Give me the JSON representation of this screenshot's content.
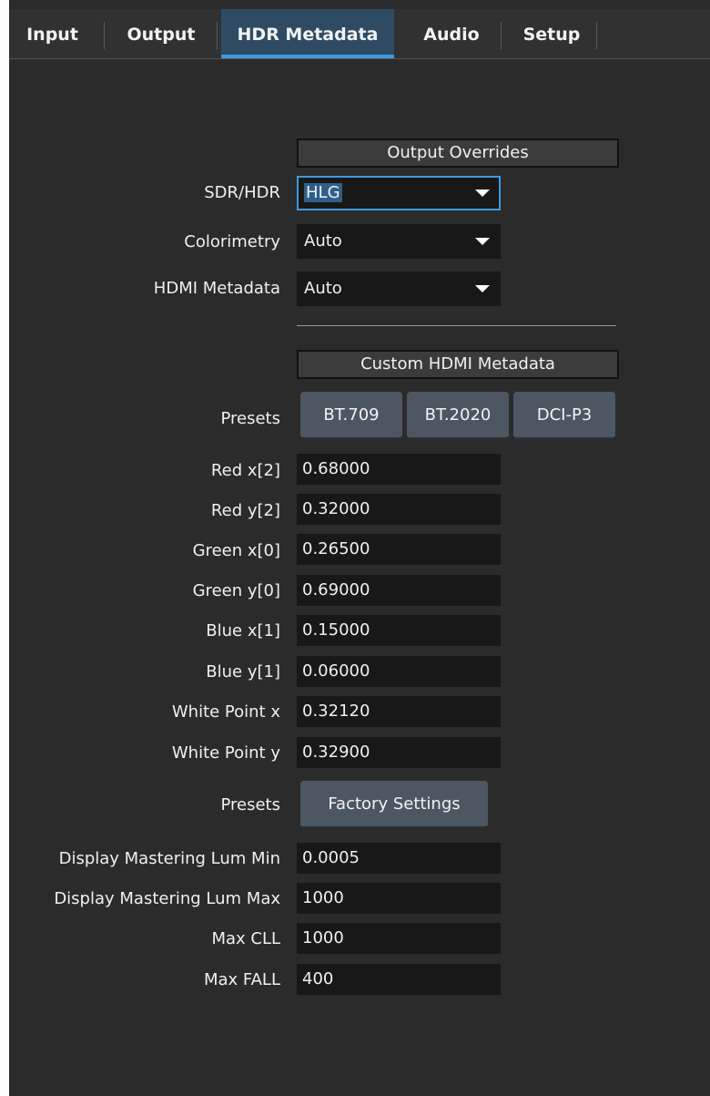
{
  "tabs": [
    "Input",
    "Output",
    "HDR Metadata",
    "Audio",
    "Setup"
  ],
  "active_tab": "HDR Metadata",
  "output_overrides": {
    "header": "Output Overrides",
    "sdr_hdr": {
      "label": "SDR/HDR",
      "value": "HLG"
    },
    "colorimetry": {
      "label": "Colorimetry",
      "value": "Auto"
    },
    "hdmi_metadata": {
      "label": "HDMI Metadata",
      "value": "Auto"
    }
  },
  "custom_metadata": {
    "header": "Custom HDMI Metadata",
    "presets_label": "Presets",
    "preset_buttons": [
      "BT.709",
      "BT.2020",
      "DCI-P3"
    ],
    "fields": [
      {
        "label": "Red x[2]",
        "value": "0.68000"
      },
      {
        "label": "Red y[2]",
        "value": "0.32000"
      },
      {
        "label": "Green x[0]",
        "value": "0.26500"
      },
      {
        "label": "Green y[0]",
        "value": "0.69000"
      },
      {
        "label": "Blue x[1]",
        "value": "0.15000"
      },
      {
        "label": "Blue y[1]",
        "value": "0.06000"
      },
      {
        "label": "White Point x",
        "value": "0.32120"
      },
      {
        "label": "White Point y",
        "value": "0.32900"
      }
    ],
    "presets2_label": "Presets",
    "factory_button": "Factory Settings",
    "lum_fields": [
      {
        "label": "Display Mastering Lum Min",
        "value": "0.0005"
      },
      {
        "label": "Display Mastering Lum Max",
        "value": "1000"
      },
      {
        "label": "Max CLL",
        "value": "1000"
      },
      {
        "label": "Max FALL",
        "value": "400"
      }
    ]
  },
  "colors": {
    "background": "#2b2b2b",
    "field": "#181818",
    "button": "#4d5762",
    "accent": "#3d9be0",
    "active_tab": "#2e4b63"
  }
}
